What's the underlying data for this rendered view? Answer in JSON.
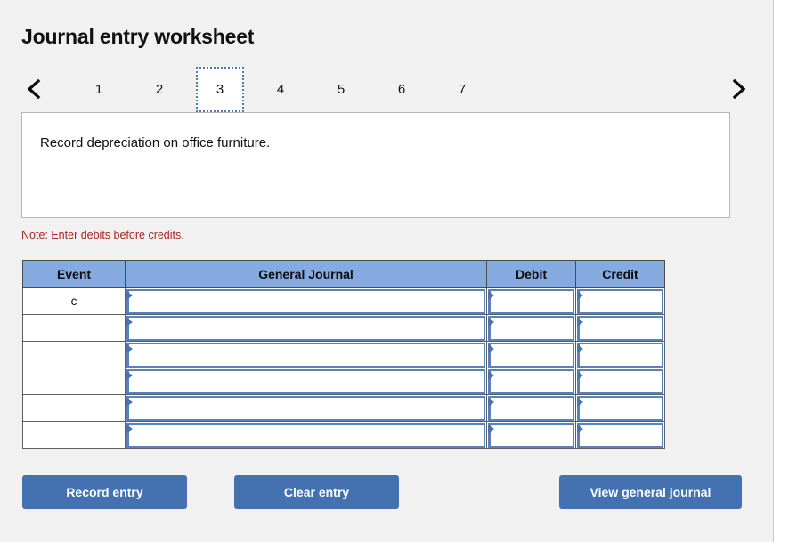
{
  "page": {
    "title": "Journal entry worksheet",
    "background_color": "#f1f1f1"
  },
  "tabs": {
    "prev_label": "‹",
    "next_label": "›",
    "prev_name": "previous-page-arrow",
    "next_name": "next-page-arrow",
    "items": [
      {
        "label": "1",
        "active": false
      },
      {
        "label": "2",
        "active": false
      },
      {
        "label": "3",
        "active": true
      },
      {
        "label": "4",
        "active": false
      },
      {
        "label": "5",
        "active": false
      },
      {
        "label": "6",
        "active": false
      },
      {
        "label": "7",
        "active": false
      }
    ],
    "active_index": 2,
    "active_border_color": "#4a7ebb"
  },
  "description": {
    "text": "Record depreciation on office furniture."
  },
  "note": {
    "text": "Note: Enter debits before credits.",
    "color": "#a52824"
  },
  "journal_table": {
    "header_color": "#85aae0",
    "columns": [
      {
        "key": "event",
        "label": "Event"
      },
      {
        "key": "journal",
        "label": "General Journal"
      },
      {
        "key": "debit",
        "label": "Debit"
      },
      {
        "key": "credit",
        "label": "Credit"
      }
    ],
    "rows": [
      {
        "event": "c",
        "journal": "",
        "debit": "",
        "credit": ""
      },
      {
        "event": "",
        "journal": "",
        "debit": "",
        "credit": ""
      },
      {
        "event": "",
        "journal": "",
        "debit": "",
        "credit": ""
      },
      {
        "event": "",
        "journal": "",
        "debit": "",
        "credit": ""
      },
      {
        "event": "",
        "journal": "",
        "debit": "",
        "credit": ""
      },
      {
        "event": "",
        "journal": "",
        "debit": "",
        "credit": ""
      }
    ]
  },
  "buttons": {
    "record_entry": "Record entry",
    "clear_entry": "Clear entry",
    "view_general_journal": "View general journal",
    "color": "#4472b0"
  }
}
